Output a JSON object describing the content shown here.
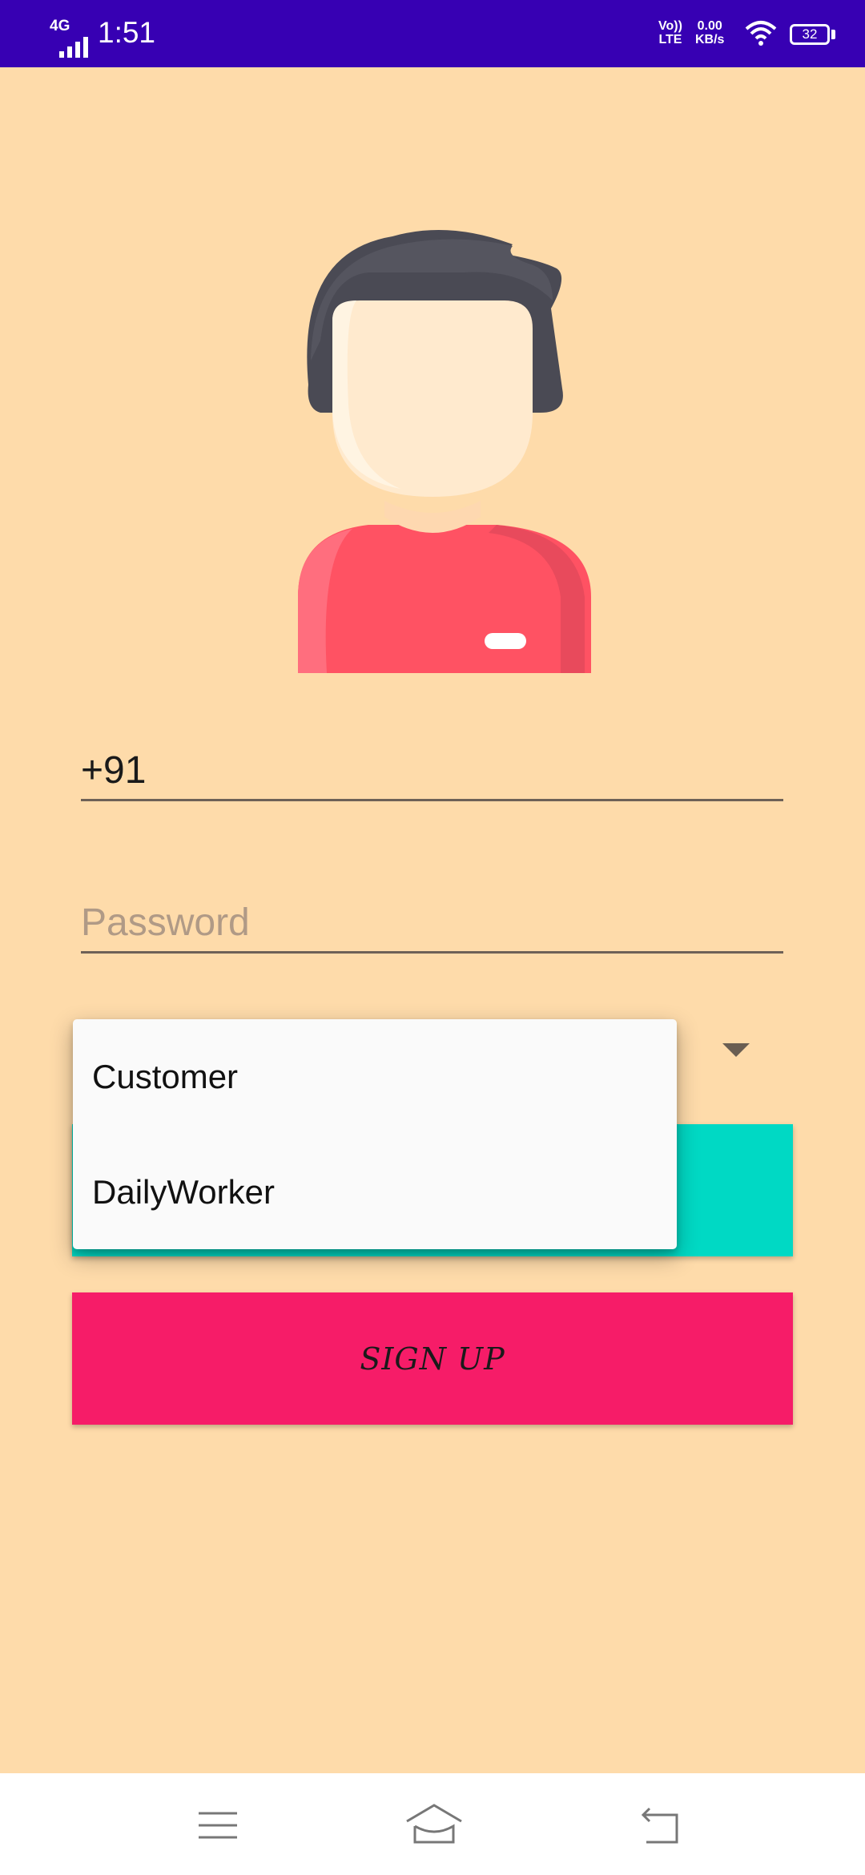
{
  "status_bar": {
    "network_type": "4G",
    "time": "1:51",
    "volte_top": "Vo))",
    "volte_bottom": "LTE",
    "speed_value": "0.00",
    "speed_unit": "KB/s",
    "battery_level": "32",
    "background_color": "#3700B3",
    "icons": [
      "signal-icon",
      "wifi-icon",
      "battery-icon"
    ]
  },
  "form": {
    "phone_value": "+91",
    "password_placeholder": "Password"
  },
  "role_dropdown": {
    "options": [
      "Customer",
      "DailyWorker"
    ]
  },
  "buttons": {
    "signup_label": "SIGN UP",
    "login_color": "#00D9C4",
    "signup_color": "#F61C68"
  },
  "nav_bar": {
    "icons": [
      "menu-icon",
      "home-icon",
      "back-icon"
    ]
  },
  "theme": {
    "background_color": "#FEDBAA"
  }
}
